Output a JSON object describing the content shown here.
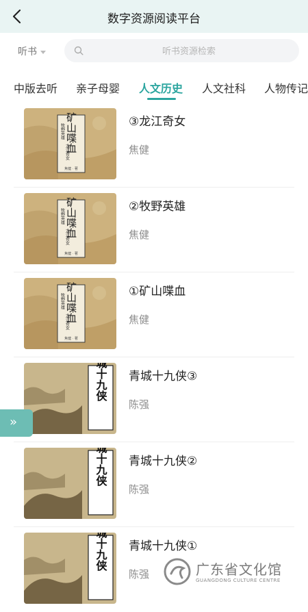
{
  "header": {
    "title": "数字资源阅读平台"
  },
  "search": {
    "type_label": "听书",
    "placeholder": "听书资源检索"
  },
  "tabs": [
    {
      "label": "中版去听"
    },
    {
      "label": "亲子母婴"
    },
    {
      "label": "人文历史",
      "active": true
    },
    {
      "label": "人文社科"
    },
    {
      "label": "人物传记"
    }
  ],
  "items": [
    {
      "title": "③龙江奇女",
      "author": "焦健",
      "cover": "矿山喋血"
    },
    {
      "title": "②牧野英雄",
      "author": "焦健",
      "cover": "矿山喋血"
    },
    {
      "title": "①矿山喋血",
      "author": "焦健",
      "cover": "矿山喋血"
    },
    {
      "title": "青城十九侠③",
      "author": "陈强",
      "cover": "青城十九侠"
    },
    {
      "title": "青城十九侠②",
      "author": "陈强",
      "cover": "青城十九侠"
    },
    {
      "title": "青城十九侠①",
      "author": "陈强",
      "cover": "青城十九侠"
    }
  ],
  "cover_a": {
    "main": "矿山喋血",
    "side1": "牧野英雄",
    "side2": "龙江奇女",
    "footer": "焦健 · 著"
  },
  "cover_b": {
    "main": "青城十九侠"
  },
  "watermark": {
    "text": "广东省文化馆",
    "sub": "GUANGDONG CULTURE CENTRE"
  },
  "colors": {
    "accent": "#2ba59f",
    "header_bg": "#e9f4f3",
    "side_button": "#6dbdb4"
  },
  "icons": {
    "back": "chevron-left-icon",
    "search": "search-icon",
    "expand": "double-chevron-right-icon"
  }
}
